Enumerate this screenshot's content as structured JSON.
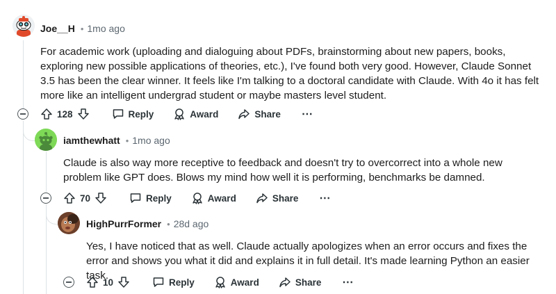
{
  "comments": [
    {
      "author": "Joe__H",
      "separator": "•",
      "time": "1mo ago",
      "body": "For academic work (uploading and dialoguing about PDFs, brainstorming about new papers, books, exploring new possible applications of theories, etc.), I've found both very good. However, Claude Sonnet 3.5 has been the clear winner. It feels like I'm talking to a doctoral candidate with Claude. With 4o it has felt more like an intelligent undergrad student or maybe masters level student.",
      "votes": "128",
      "reply_label": "Reply",
      "award_label": "Award",
      "share_label": "Share",
      "more_label": "⋯"
    },
    {
      "author": "iamthewhatt",
      "separator": "•",
      "time": "1mo ago",
      "body": "Claude is also way more receptive to feedback and doesn't try to overcorrect into a whole new problem like GPT does. Blows my mind how well it is performing, benchmarks be damned.",
      "votes": "70",
      "reply_label": "Reply",
      "award_label": "Award",
      "share_label": "Share",
      "more_label": "⋯"
    },
    {
      "author": "HighPurrFormer",
      "separator": "•",
      "time": "28d ago",
      "body": "Yes, I have noticed that as well. Claude actually apologizes when an error occurs and fixes the error and shows you what it did and explains it in full detail. It's made learning Python an easier task.",
      "votes": "10",
      "reply_label": "Reply",
      "award_label": "Award",
      "share_label": "Share",
      "more_label": "⋯"
    }
  ],
  "colors": {
    "text": "#1c1c1c",
    "meta": "#5c6770",
    "thread_line": "#dde2e5",
    "avatar_green": "#7ed957"
  },
  "icons": [
    "upvote-icon",
    "downvote-icon",
    "reply-icon",
    "award-icon",
    "share-icon",
    "more-icon",
    "collapse-icon"
  ]
}
